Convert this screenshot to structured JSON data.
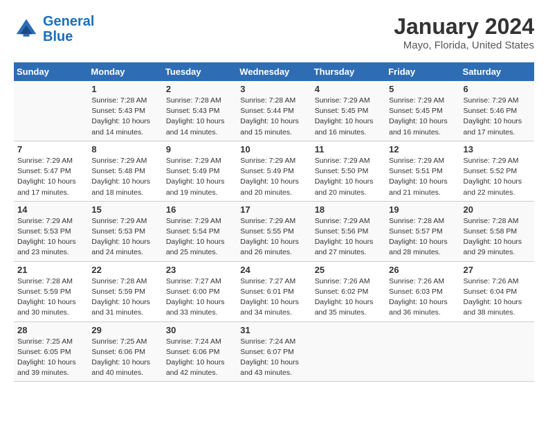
{
  "header": {
    "logo_line1": "General",
    "logo_line2": "Blue",
    "title": "January 2024",
    "subtitle": "Mayo, Florida, United States"
  },
  "columns": [
    "Sunday",
    "Monday",
    "Tuesday",
    "Wednesday",
    "Thursday",
    "Friday",
    "Saturday"
  ],
  "weeks": [
    [
      {
        "num": "",
        "info": ""
      },
      {
        "num": "1",
        "info": "Sunrise: 7:28 AM\nSunset: 5:43 PM\nDaylight: 10 hours\nand 14 minutes."
      },
      {
        "num": "2",
        "info": "Sunrise: 7:28 AM\nSunset: 5:43 PM\nDaylight: 10 hours\nand 14 minutes."
      },
      {
        "num": "3",
        "info": "Sunrise: 7:28 AM\nSunset: 5:44 PM\nDaylight: 10 hours\nand 15 minutes."
      },
      {
        "num": "4",
        "info": "Sunrise: 7:29 AM\nSunset: 5:45 PM\nDaylight: 10 hours\nand 16 minutes."
      },
      {
        "num": "5",
        "info": "Sunrise: 7:29 AM\nSunset: 5:45 PM\nDaylight: 10 hours\nand 16 minutes."
      },
      {
        "num": "6",
        "info": "Sunrise: 7:29 AM\nSunset: 5:46 PM\nDaylight: 10 hours\nand 17 minutes."
      }
    ],
    [
      {
        "num": "7",
        "info": "Sunrise: 7:29 AM\nSunset: 5:47 PM\nDaylight: 10 hours\nand 17 minutes."
      },
      {
        "num": "8",
        "info": "Sunrise: 7:29 AM\nSunset: 5:48 PM\nDaylight: 10 hours\nand 18 minutes."
      },
      {
        "num": "9",
        "info": "Sunrise: 7:29 AM\nSunset: 5:49 PM\nDaylight: 10 hours\nand 19 minutes."
      },
      {
        "num": "10",
        "info": "Sunrise: 7:29 AM\nSunset: 5:49 PM\nDaylight: 10 hours\nand 20 minutes."
      },
      {
        "num": "11",
        "info": "Sunrise: 7:29 AM\nSunset: 5:50 PM\nDaylight: 10 hours\nand 20 minutes."
      },
      {
        "num": "12",
        "info": "Sunrise: 7:29 AM\nSunset: 5:51 PM\nDaylight: 10 hours\nand 21 minutes."
      },
      {
        "num": "13",
        "info": "Sunrise: 7:29 AM\nSunset: 5:52 PM\nDaylight: 10 hours\nand 22 minutes."
      }
    ],
    [
      {
        "num": "14",
        "info": "Sunrise: 7:29 AM\nSunset: 5:53 PM\nDaylight: 10 hours\nand 23 minutes."
      },
      {
        "num": "15",
        "info": "Sunrise: 7:29 AM\nSunset: 5:53 PM\nDaylight: 10 hours\nand 24 minutes."
      },
      {
        "num": "16",
        "info": "Sunrise: 7:29 AM\nSunset: 5:54 PM\nDaylight: 10 hours\nand 25 minutes."
      },
      {
        "num": "17",
        "info": "Sunrise: 7:29 AM\nSunset: 5:55 PM\nDaylight: 10 hours\nand 26 minutes."
      },
      {
        "num": "18",
        "info": "Sunrise: 7:29 AM\nSunset: 5:56 PM\nDaylight: 10 hours\nand 27 minutes."
      },
      {
        "num": "19",
        "info": "Sunrise: 7:28 AM\nSunset: 5:57 PM\nDaylight: 10 hours\nand 28 minutes."
      },
      {
        "num": "20",
        "info": "Sunrise: 7:28 AM\nSunset: 5:58 PM\nDaylight: 10 hours\nand 29 minutes."
      }
    ],
    [
      {
        "num": "21",
        "info": "Sunrise: 7:28 AM\nSunset: 5:59 PM\nDaylight: 10 hours\nand 30 minutes."
      },
      {
        "num": "22",
        "info": "Sunrise: 7:28 AM\nSunset: 5:59 PM\nDaylight: 10 hours\nand 31 minutes."
      },
      {
        "num": "23",
        "info": "Sunrise: 7:27 AM\nSunset: 6:00 PM\nDaylight: 10 hours\nand 33 minutes."
      },
      {
        "num": "24",
        "info": "Sunrise: 7:27 AM\nSunset: 6:01 PM\nDaylight: 10 hours\nand 34 minutes."
      },
      {
        "num": "25",
        "info": "Sunrise: 7:26 AM\nSunset: 6:02 PM\nDaylight: 10 hours\nand 35 minutes."
      },
      {
        "num": "26",
        "info": "Sunrise: 7:26 AM\nSunset: 6:03 PM\nDaylight: 10 hours\nand 36 minutes."
      },
      {
        "num": "27",
        "info": "Sunrise: 7:26 AM\nSunset: 6:04 PM\nDaylight: 10 hours\nand 38 minutes."
      }
    ],
    [
      {
        "num": "28",
        "info": "Sunrise: 7:25 AM\nSunset: 6:05 PM\nDaylight: 10 hours\nand 39 minutes."
      },
      {
        "num": "29",
        "info": "Sunrise: 7:25 AM\nSunset: 6:06 PM\nDaylight: 10 hours\nand 40 minutes."
      },
      {
        "num": "30",
        "info": "Sunrise: 7:24 AM\nSunset: 6:06 PM\nDaylight: 10 hours\nand 42 minutes."
      },
      {
        "num": "31",
        "info": "Sunrise: 7:24 AM\nSunset: 6:07 PM\nDaylight: 10 hours\nand 43 minutes."
      },
      {
        "num": "",
        "info": ""
      },
      {
        "num": "",
        "info": ""
      },
      {
        "num": "",
        "info": ""
      }
    ]
  ]
}
